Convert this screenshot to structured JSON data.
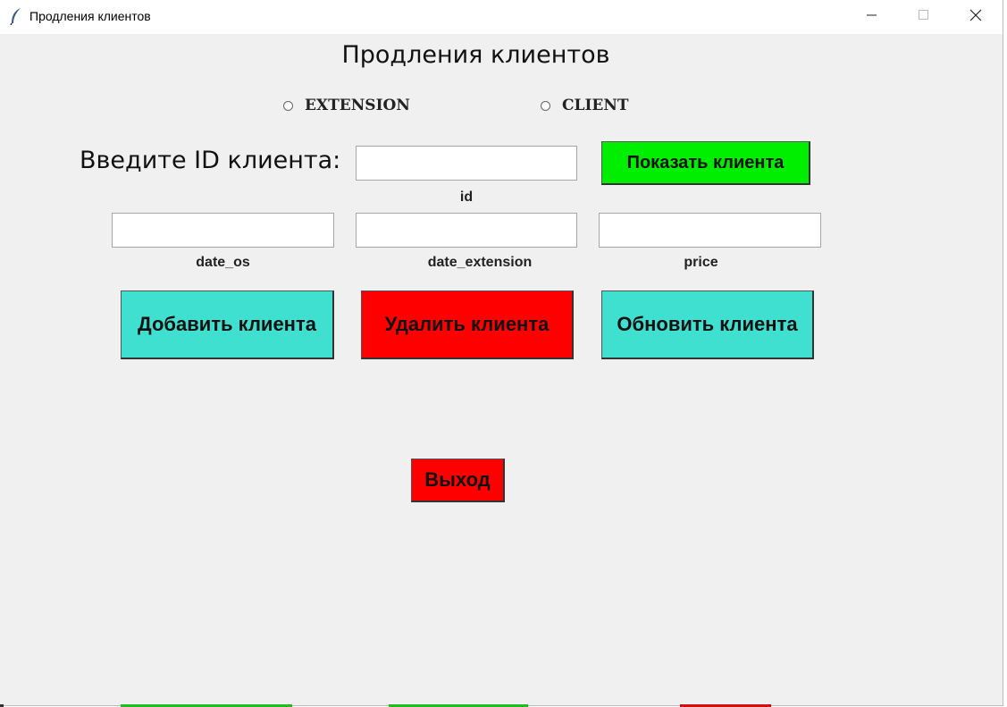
{
  "window": {
    "title": "Продления клиентов",
    "controls": [
      "minimize",
      "maximize",
      "close"
    ]
  },
  "heading": "Продления клиентов",
  "radios": [
    {
      "label": "EXTENSION",
      "selected": false
    },
    {
      "label": "CLIENT",
      "selected": false
    }
  ],
  "search": {
    "prompt": "Введите ID клиента:",
    "value": "",
    "id_caption": "id",
    "show_button": "Показать клиента"
  },
  "fields": {
    "date_os": {
      "label": "date_os",
      "value": ""
    },
    "date_extension": {
      "label": "date_extension",
      "value": ""
    },
    "price": {
      "label": "price",
      "value": ""
    }
  },
  "actions": {
    "add": "Добавить клиента",
    "delete": "Удалить клиента",
    "update": "Обновить клиента",
    "exit": "Выход"
  },
  "colors": {
    "window_bg": "#f0f0f0",
    "teal": "#40e0d0",
    "red": "#ff0000",
    "green": "#00ee00"
  }
}
